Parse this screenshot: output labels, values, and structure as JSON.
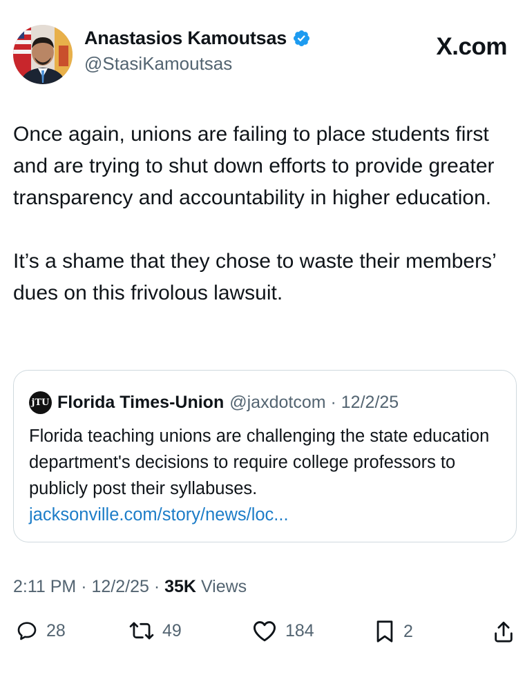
{
  "tweet": {
    "author": {
      "name": "Anastasios Kamoutsas",
      "handle": "@StasiKamoutsas",
      "verified_icon": "verified-badge-icon"
    },
    "brand": "X.com",
    "text": [
      "Once again, unions are failing to place students first and are trying to shut down efforts to provide greater transparency and accountability in higher education.",
      "It’s a shame that they chose to waste their members’ dues on this frivolous lawsuit."
    ],
    "quoted": {
      "logo_text": "jTU",
      "name": "Florida Times-Union",
      "handle": "@jaxdotcom",
      "date": "12/2/25",
      "text": "Florida teaching unions are challenging the state education department's decisions to require college professors to publicly post their syllabuses.",
      "link": "jacksonville.com/story/news/loc..."
    },
    "timestamp": {
      "time": "2:11 PM",
      "date": "12/2/25",
      "views_count": "35K",
      "views_label": "Views"
    },
    "actions": {
      "replies": "28",
      "reposts": "49",
      "likes": "184",
      "bookmarks": "2"
    }
  },
  "colors": {
    "text": "#0f1419",
    "secondary": "#536471",
    "link": "#1d7dc8",
    "verified": "#1d9bf0",
    "border": "#cfd9de"
  }
}
